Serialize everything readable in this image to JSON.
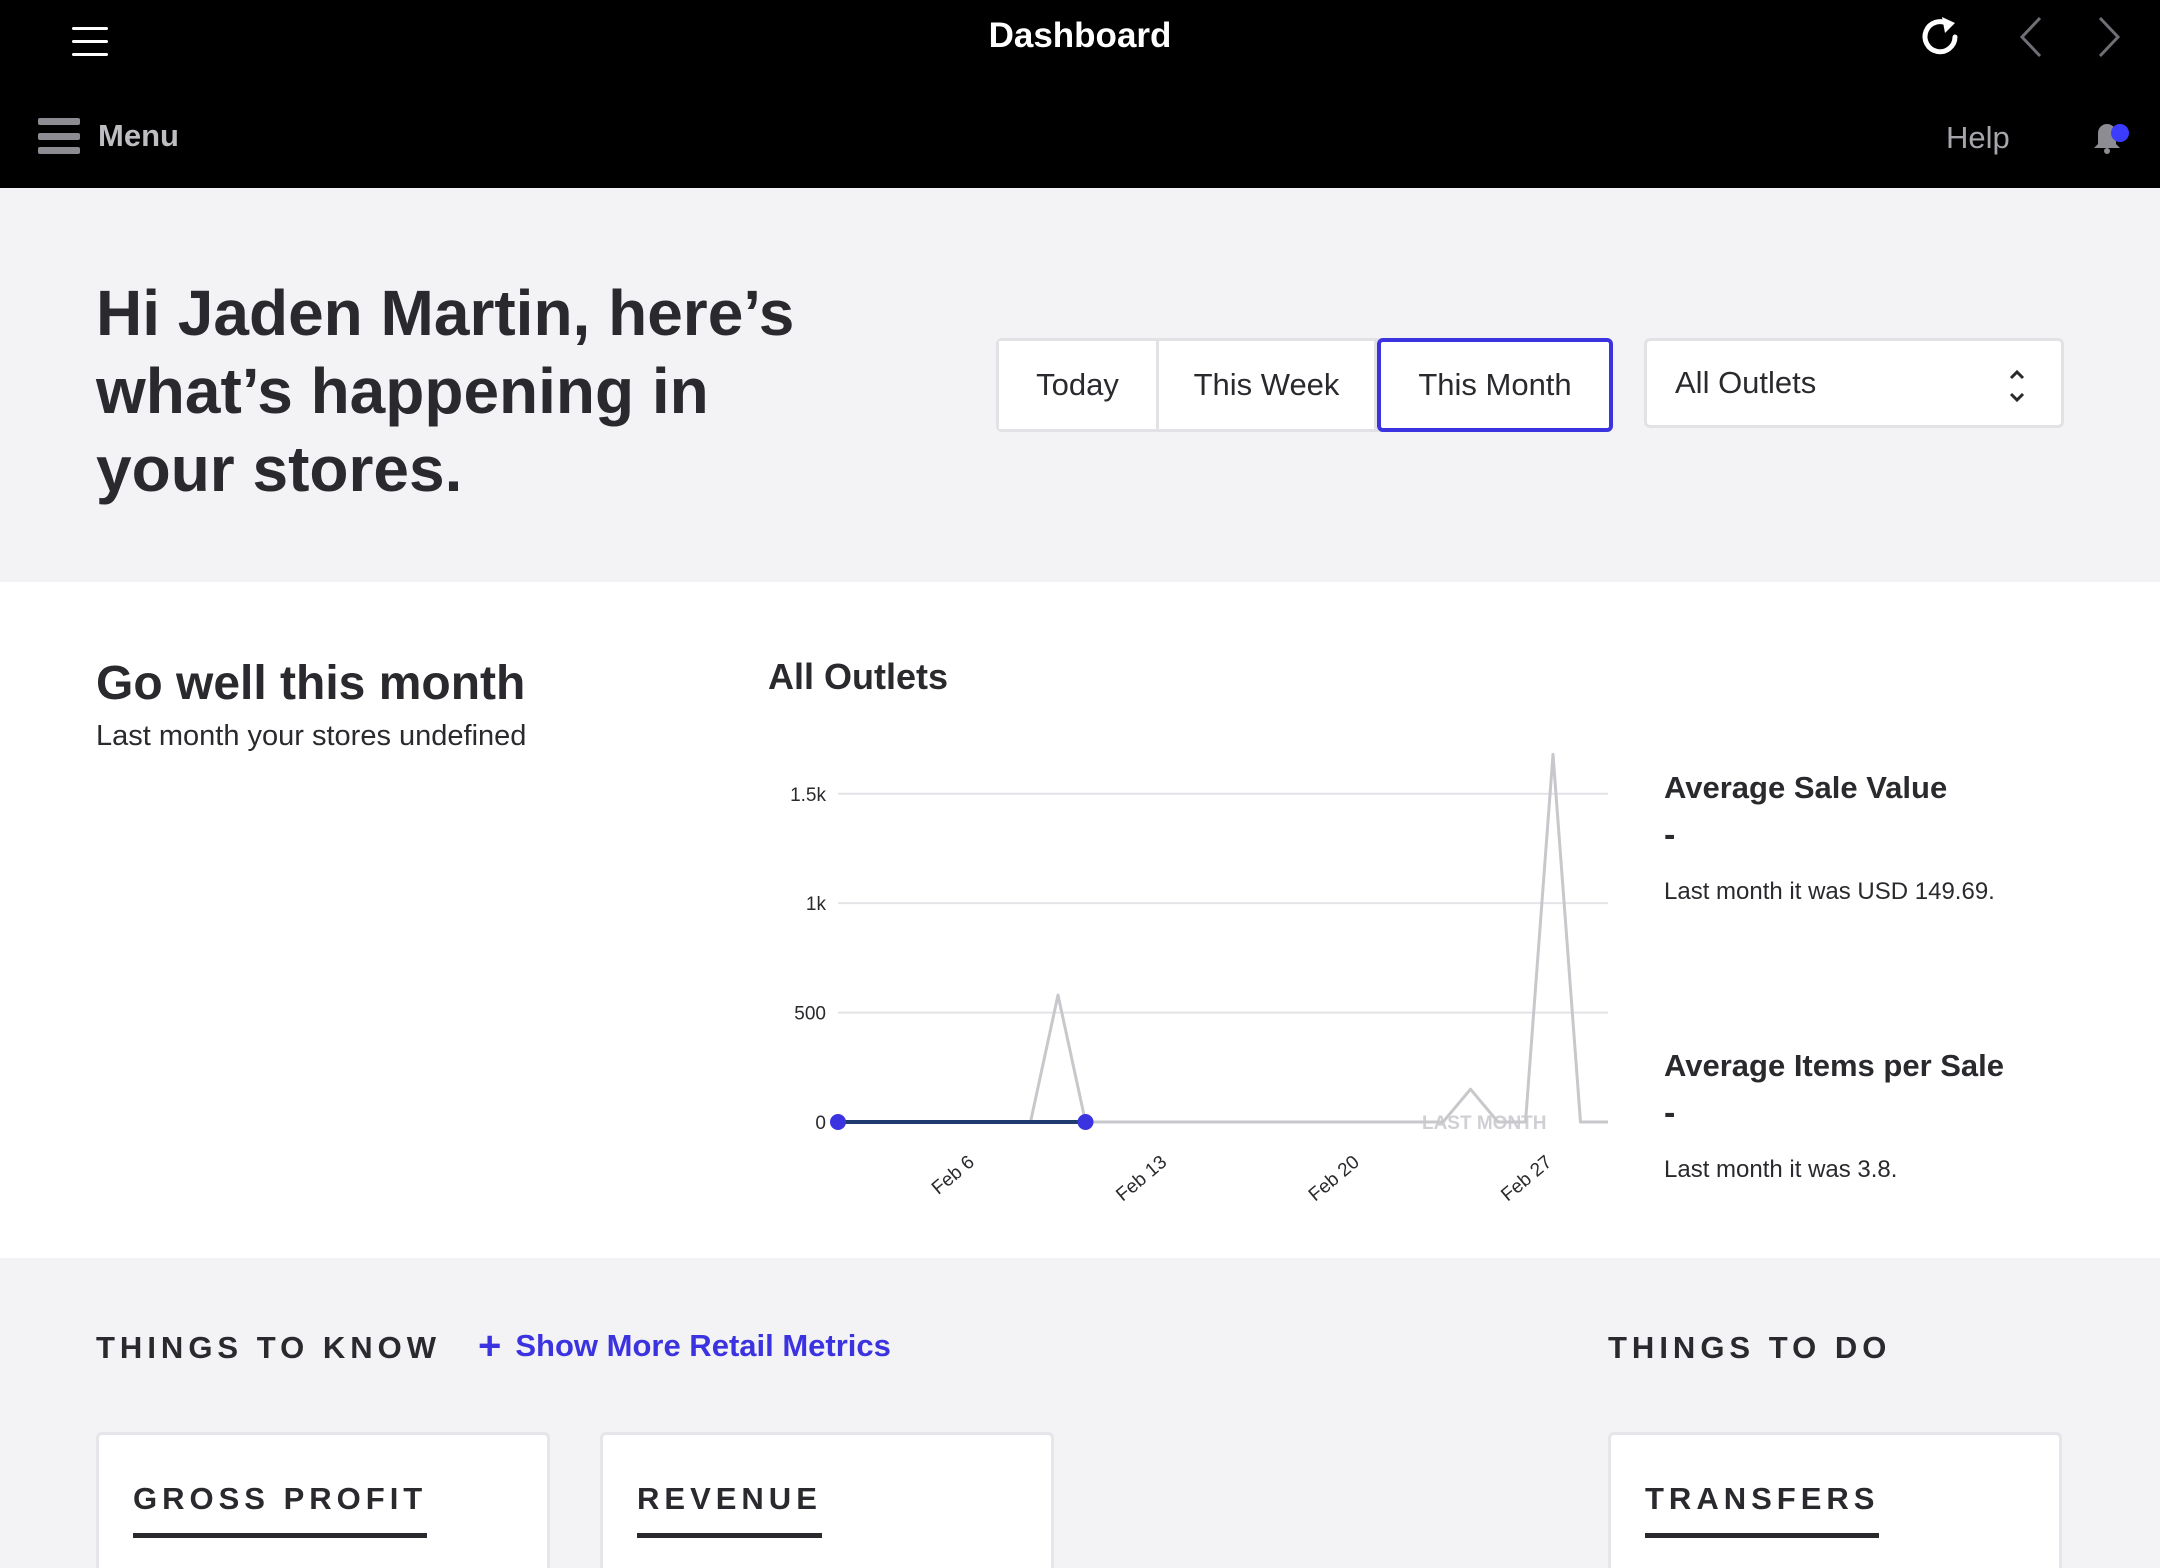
{
  "app": {
    "title": "Dashboard",
    "menu_label": "Menu",
    "help_label": "Help",
    "notification_dot_color": "#3c3cff"
  },
  "greeting": "Hi Jaden Martin, here’s what’s happening in your stores.",
  "date_range": {
    "options": [
      "Today",
      "This Week",
      "This Month"
    ],
    "selected": "This Month"
  },
  "outlet_select": {
    "value": "All Outlets"
  },
  "summary": {
    "title": "Go well this month",
    "subtitle": "Last month your stores undefined"
  },
  "chart_title": "All Outlets",
  "chart_data": {
    "type": "line",
    "title": "All Outlets",
    "x_ticks": [
      "Feb 6",
      "Feb 13",
      "Feb 20",
      "Feb 27"
    ],
    "y_ticks": [
      "0",
      "500",
      "1k",
      "1.5k"
    ],
    "ylim": [
      0,
      1700
    ],
    "grid": true,
    "annotation": "LAST MONTH",
    "series": [
      {
        "color": "#c8c8cc",
        "x": [
          1,
          2,
          3,
          4,
          5,
          6,
          7,
          8,
          9,
          10,
          11,
          12,
          13,
          14,
          15,
          16,
          17,
          18,
          19,
          20,
          21,
          22,
          23,
          24,
          25,
          26,
          27,
          28,
          29
        ],
        "y": [
          0,
          0,
          0,
          0,
          0,
          0,
          0,
          0,
          580,
          0,
          0,
          0,
          0,
          0,
          0,
          0,
          0,
          0,
          0,
          0,
          0,
          0,
          0,
          150,
          0,
          0,
          1680,
          0,
          0
        ]
      },
      {
        "color": "#1f3a6e",
        "marker_color": "#3c33e0",
        "x": [
          1,
          2,
          3,
          4,
          5,
          6,
          7,
          8,
          9,
          10
        ],
        "y": [
          0,
          0,
          0,
          0,
          0,
          0,
          0,
          0,
          0,
          0
        ]
      }
    ]
  },
  "metrics": [
    {
      "title": "Average Sale Value",
      "value": "-",
      "note": "Last month it was USD 149.69."
    },
    {
      "title": "Average Items per Sale",
      "value": "-",
      "note": "Last month it was 3.8."
    }
  ],
  "things_to_know": {
    "heading": "THINGS TO KNOW",
    "show_more": "Show More Retail Metrics",
    "cards": [
      "GROSS PROFIT",
      "REVENUE"
    ]
  },
  "things_to_do": {
    "heading": "THINGS TO DO",
    "cards": [
      "TRANSFERS"
    ]
  }
}
